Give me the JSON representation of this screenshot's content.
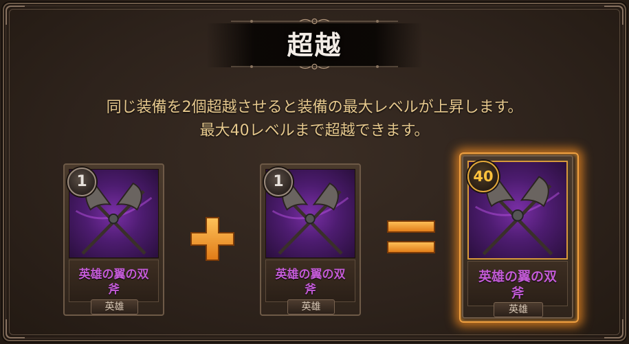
{
  "title": "超越",
  "description": {
    "line1": "同じ装備を2個超越させると装備の最大レベルが上昇します。",
    "line2": "最大40レベルまで超越できます。"
  },
  "cards": [
    {
      "level": "1",
      "name_line1": "英雄の翼の双",
      "name_line2": "斧",
      "rarity": "英雄"
    },
    {
      "level": "1",
      "name_line1": "英雄の翼の双",
      "name_line2": "斧",
      "rarity": "英雄"
    },
    {
      "level": "40",
      "name_line1": "英雄の翼の双",
      "name_line2": "斧",
      "rarity": "英雄"
    }
  ],
  "operators": {
    "plus": "plus-icon",
    "equals": "equals-icon"
  },
  "colors": {
    "accent_orange": "#f0a040",
    "description_text": "#e7c98e",
    "item_name": "#c35bd6",
    "card_art_purple": "#4d1c70"
  }
}
